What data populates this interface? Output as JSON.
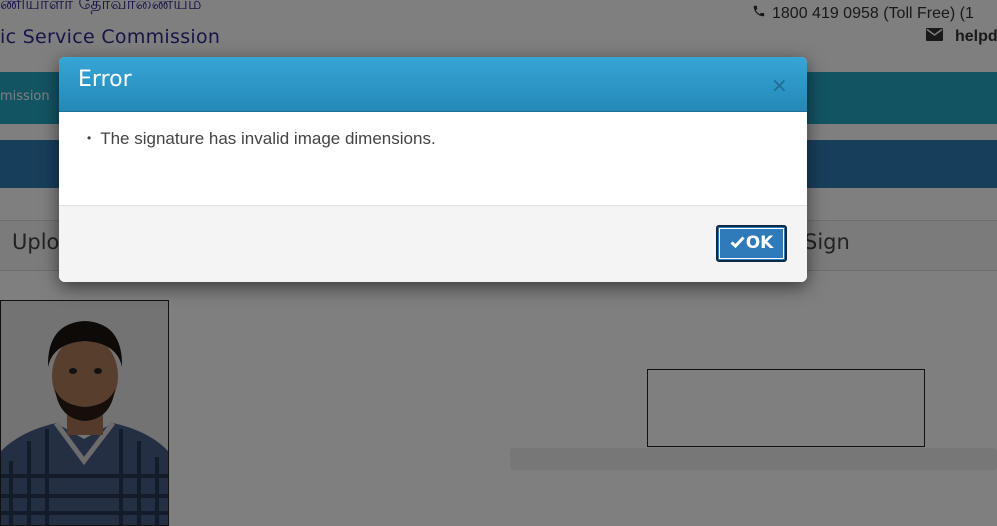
{
  "header": {
    "tamil_title": "ணியாளர் தேர்வாணையம்",
    "title": "ic Service Commission",
    "phone": "1800 419 0958 (Toll Free)  (1",
    "email": "helpd"
  },
  "nav": {
    "label": "mission"
  },
  "panel": {
    "left_heading": "Uplo",
    "right_heading": "Sign"
  },
  "dialog": {
    "title": "Error",
    "close_label": "×",
    "messages": [
      "The signature has invalid image dimensions."
    ],
    "ok_label": "OK"
  },
  "icons": {
    "phone": "phone-icon",
    "email": "envelope-icon",
    "ok": "check-icon"
  },
  "colors": {
    "dialog_header": "#2a95c8",
    "ok_button": "#2f7ab8",
    "navbar": "#27a9c7",
    "bluebar": "#2f7fb8"
  }
}
